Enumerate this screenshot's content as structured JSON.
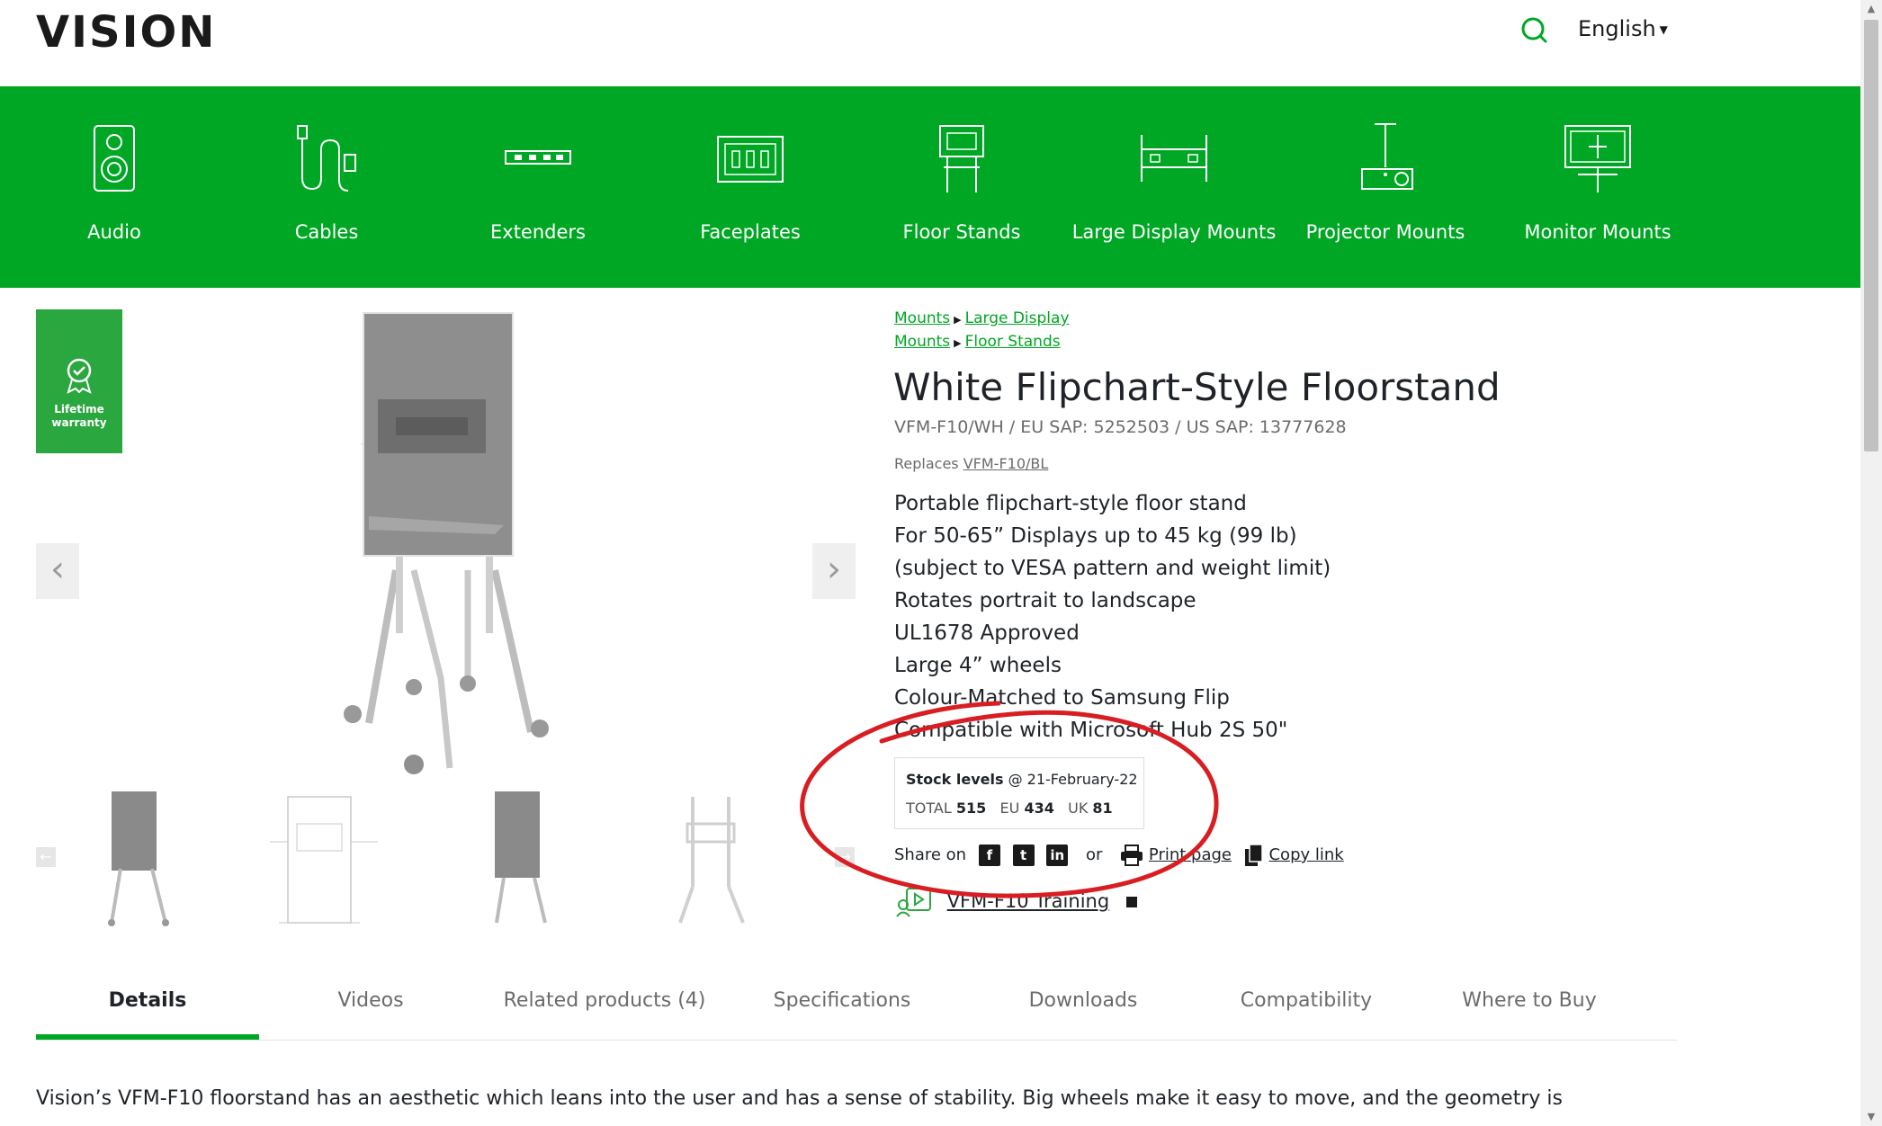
{
  "header": {
    "logo": "VISION",
    "language": "English"
  },
  "categories": [
    {
      "label": "Audio",
      "icon": "speaker-icon"
    },
    {
      "label": "Cables",
      "icon": "cable-icon"
    },
    {
      "label": "Extenders",
      "icon": "extender-icon"
    },
    {
      "label": "Faceplates",
      "icon": "faceplate-icon"
    },
    {
      "label": "Floor Stands",
      "icon": "floor-stand-icon"
    },
    {
      "label": "Large Display Mounts",
      "icon": "large-display-mount-icon"
    },
    {
      "label": "Projector Mounts",
      "icon": "projector-mount-icon"
    },
    {
      "label": "Monitor Mounts",
      "icon": "monitor-mount-icon"
    }
  ],
  "badge": {
    "line1": "Lifetime",
    "line2": "warranty"
  },
  "breadcrumbs": {
    "row1": [
      "Mounts",
      "Large Display"
    ],
    "row2": [
      "Mounts",
      "Floor Stands"
    ]
  },
  "product": {
    "title": "White Flipchart-Style Floorstand",
    "codes": "VFM-F10/WH / EU SAP: 5252503 / US SAP: 13777628",
    "replaces_label": "Replaces",
    "replaces_link": "VFM-F10/BL",
    "features": [
      "Portable flipchart-style floor stand",
      "For 50-65” Displays up to 45 kg (99 lb)",
      "(subject to VESA pattern and weight limit)",
      "Rotates portrait to landscape",
      "UL1678 Approved",
      "Large 4” wheels",
      "Colour-Matched to Samsung Flip",
      "Compatible with Microsoft Hub 2S 50\""
    ]
  },
  "stock": {
    "label": "Stock levels",
    "date": "@ 21-February-22",
    "total_label": "TOTAL",
    "total": "515",
    "eu_label": "EU",
    "eu": "434",
    "uk_label": "UK",
    "uk": "81"
  },
  "share": {
    "label": "Share on",
    "or": "or",
    "print": "Print page",
    "copy": "Copy link"
  },
  "training": {
    "label": "VFM-F10 Training"
  },
  "tabs": [
    {
      "label": "Details",
      "active": true
    },
    {
      "label": "Videos"
    },
    {
      "label": "Related products (4)"
    },
    {
      "label": "Specifications"
    },
    {
      "label": "Downloads"
    },
    {
      "label": "Compatibility"
    },
    {
      "label": "Where to Buy"
    }
  ],
  "description": "Vision’s VFM-F10 floorstand has an aesthetic which leans into the user and has a sense of stability. Big wheels make it easy to move, and the geometry is",
  "colors": {
    "brand_green": "#00a724",
    "annotation_red": "#d81e22"
  }
}
